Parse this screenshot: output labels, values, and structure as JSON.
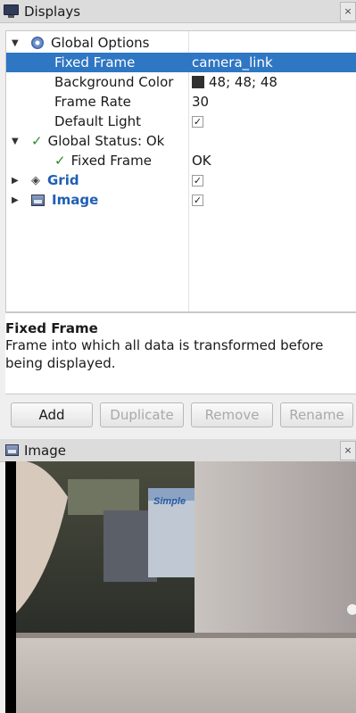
{
  "displays_panel": {
    "title": "Displays",
    "close_label": "×"
  },
  "tree": {
    "global_options": {
      "label": "Global Options",
      "fixed_frame": {
        "label": "Fixed Frame",
        "value": "camera_link"
      },
      "background_color": {
        "label": "Background Color",
        "value": "48; 48; 48",
        "swatch": "#303030"
      },
      "frame_rate": {
        "label": "Frame Rate",
        "value": "30"
      },
      "default_light": {
        "label": "Default Light",
        "checked": true
      }
    },
    "global_status": {
      "label": "Global Status: Ok",
      "fixed_frame": {
        "label": "Fixed Frame",
        "value": "OK"
      }
    },
    "displays": [
      {
        "label": "Grid",
        "checked": true
      },
      {
        "label": "Image",
        "checked": true
      }
    ]
  },
  "description": {
    "title": "Fixed Frame",
    "body_line1": "Frame into which all data is transformed before",
    "body_line2": "being displayed."
  },
  "buttons": {
    "add": "Add",
    "duplicate": "Duplicate",
    "remove": "Remove",
    "rename": "Rename"
  },
  "image_panel": {
    "title": "Image",
    "close_label": "×",
    "box_brand": "Simple"
  },
  "colors": {
    "selection": "#2f76c3",
    "status_ok": "#2c8a2c",
    "display_name": "#1f5fb3"
  }
}
